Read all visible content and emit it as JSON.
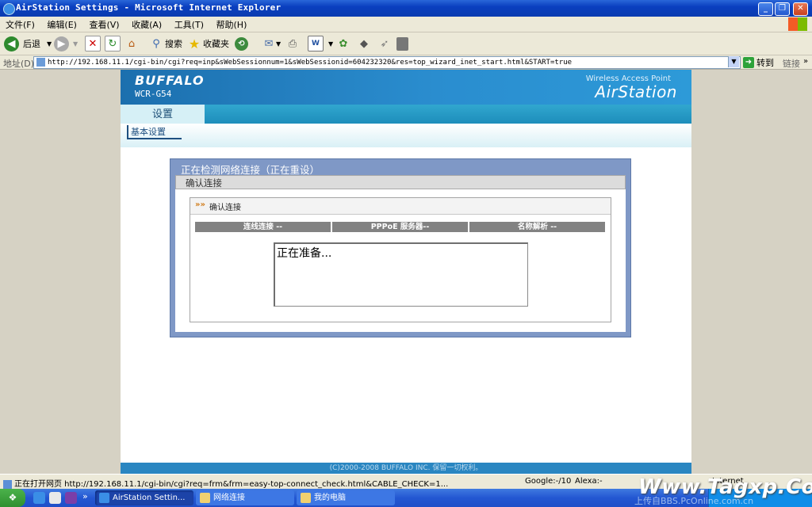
{
  "window": {
    "title": "AirStation Settings - Microsoft Internet Explorer"
  },
  "menu": [
    "文件(F)",
    "编辑(E)",
    "查看(V)",
    "收藏(A)",
    "工具(T)",
    "帮助(H)"
  ],
  "toolbar": {
    "back": "后退",
    "search": "搜索",
    "favorites": "收藏夹"
  },
  "address": {
    "label": "地址(D)",
    "url": "http://192.168.11.1/cgi-bin/cgi?req=inp&sWebSessionnum=1&sWebSessionid=604232320&res=top_wizard_inet_start.html&START=true",
    "go": "转到",
    "links": "链接"
  },
  "page": {
    "logo": "BUFFALO",
    "model": "WCR-G54",
    "product_line": "Wireless Access Point",
    "product": "AirStation",
    "tab": "设置",
    "sublink": "基本设置",
    "panel_title": "正在检测网络连接（正在重设）",
    "panel_subtitle": "确认连接",
    "inner_title": "确认连接",
    "columns": [
      "连线连接 --",
      "PPPoE 服务器--",
      "名称解析 --"
    ],
    "status": "正在准备...",
    "footer": "(C)2000-2008 BUFFALO INC. 保留一切权利。"
  },
  "statusbar": {
    "text": "正在打开网页 http://192.168.11.1/cgi-bin/cgi?req=frm&frm=easy-top-connect_check.html&CABLE_CHECK=1...",
    "google": "Google:-/10",
    "alexa": "Alexa:-",
    "zone": "Internet"
  },
  "taskbar": {
    "tasks": [
      "AirStation Settin...",
      "网络连接",
      "我的电脑"
    ]
  },
  "watermark": "Www.Tagxp.Com",
  "watermark_sub": "上传自BBS.PcOnline.com.cn"
}
